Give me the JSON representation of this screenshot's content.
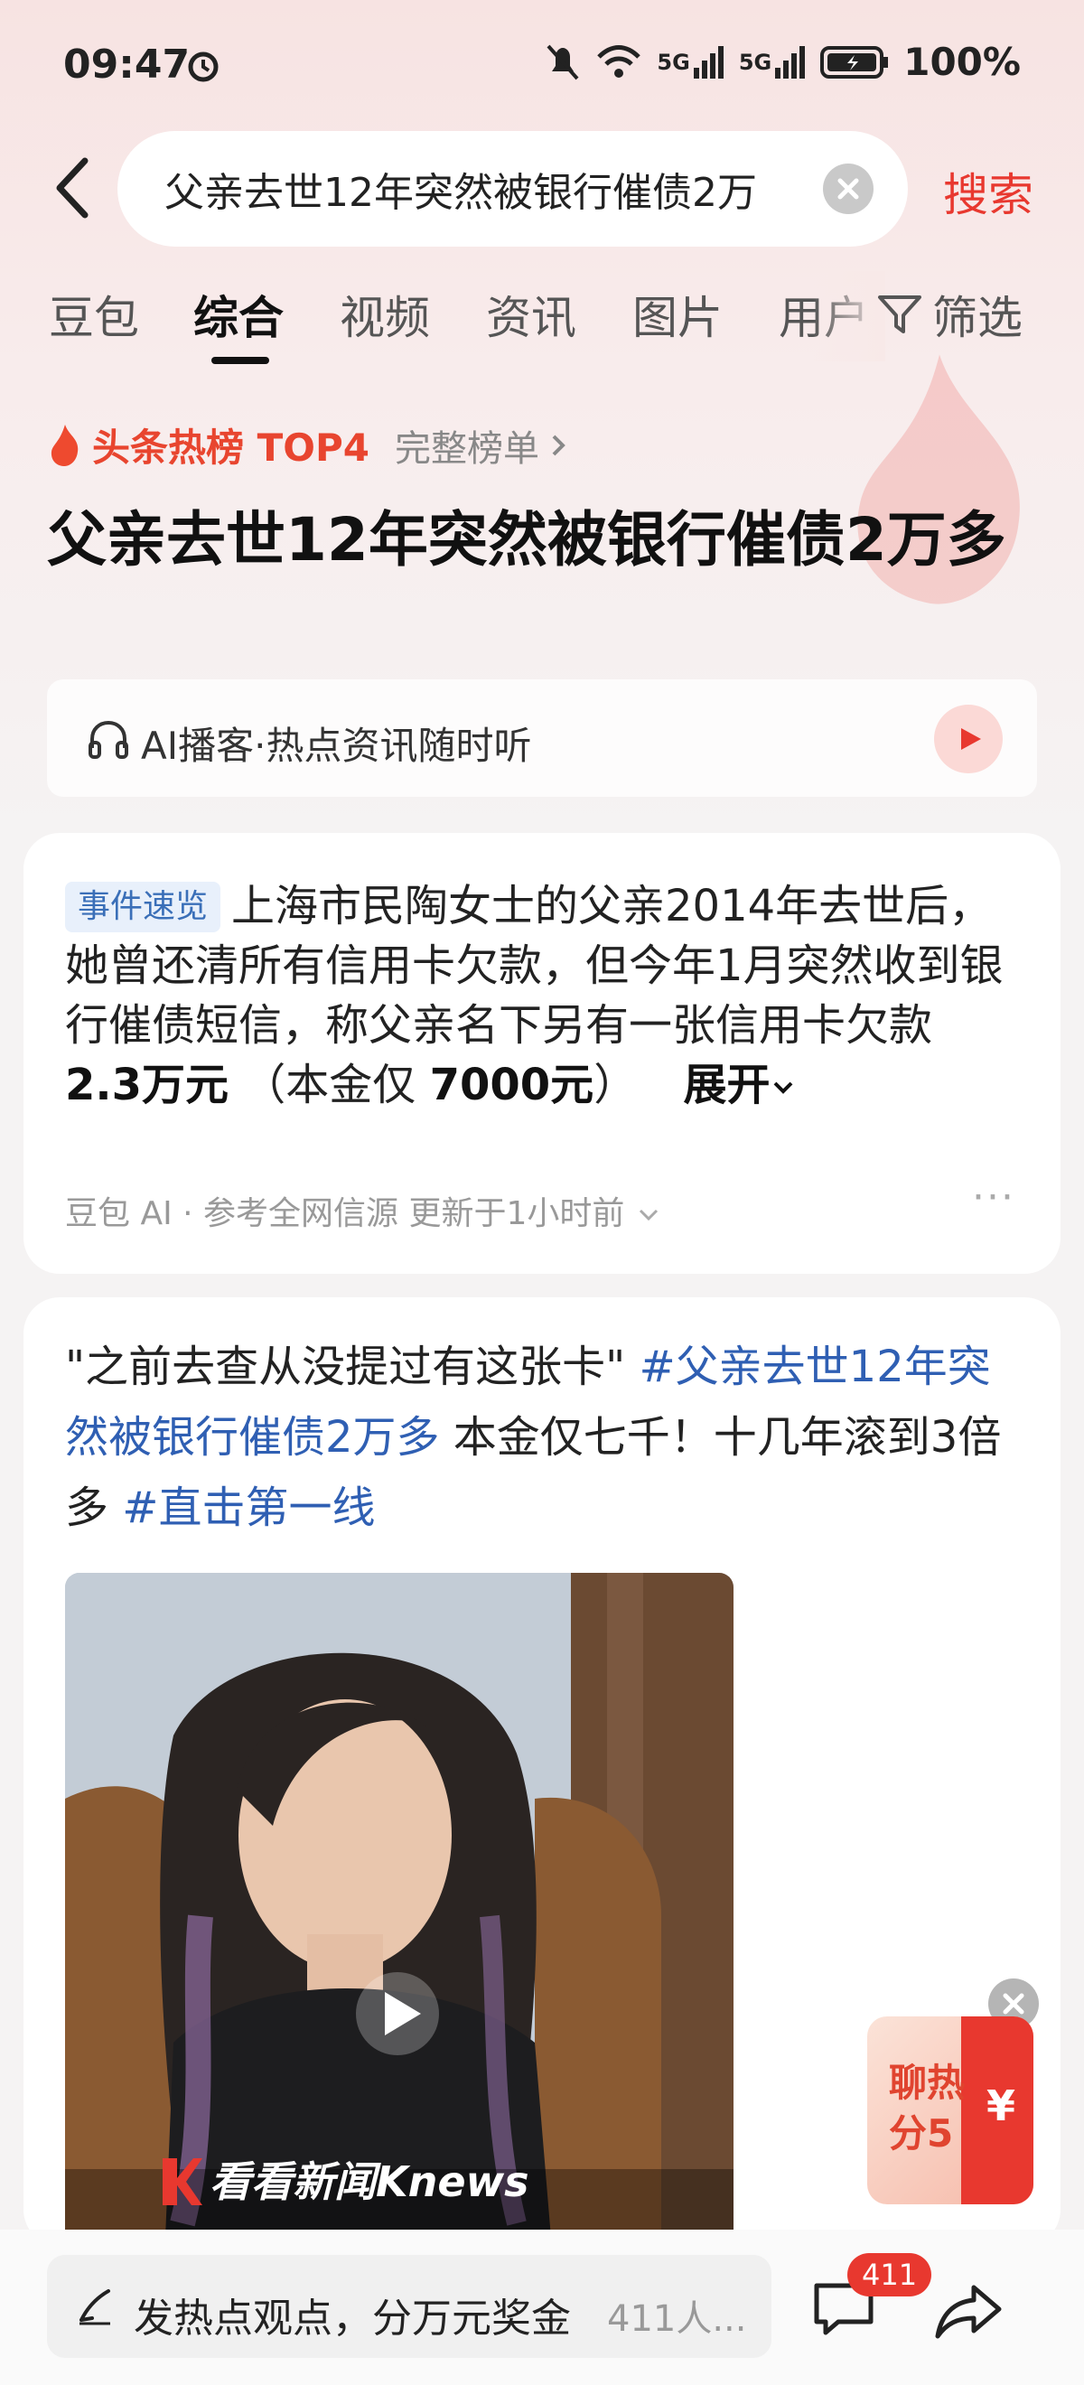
{
  "status_bar": {
    "time": "09:47",
    "network1": "5G",
    "network2": "5G",
    "battery": "100%"
  },
  "search": {
    "query": "父亲去世12年突然被银行催债2万",
    "button": "搜索"
  },
  "tabs": [
    "豆包",
    "综合",
    "视频",
    "资讯",
    "图片",
    "用户"
  ],
  "active_tab": "综合",
  "filter_label": "筛选",
  "hot": {
    "label": "头条热榜 TOP4",
    "full_list": "完整榜单"
  },
  "headline": "父亲去世12年突然被银行催债2万多",
  "ai_podcast": {
    "text": "AI播客·热点资讯随时听"
  },
  "summary_card": {
    "tag": "事件速览",
    "text_before": "上海市民陶女士的父亲2014年去世后，她曾还清所有信用卡欠款，但今年1月突然收到银行催债短信，称父亲名下另有一张信用卡欠款 ",
    "amount": "2.3万元",
    "text_mid": " （本金仅 ",
    "principal": "7000元",
    "text_after": "）",
    "expand": "展开",
    "source": "豆包 AI · 参考全网信源 更新于1小时前",
    "more": "···"
  },
  "post_card": {
    "quote": "\"之前去查从没提过有这张卡\"",
    "hashtag1": "#父亲去世12年突然被银行催债2万多",
    "middle": " 本金仅七千！十几年滚到3倍多 ",
    "hashtag2": "#直击第一线",
    "video_watermark": "看看新闻Knews"
  },
  "red_packet": {
    "line1": "聊热",
    "line2": "分5",
    "symbol": "¥"
  },
  "bottom": {
    "placeholder": "发热点观点，分万元奖金",
    "participants": "411人...",
    "comment_badge": "411"
  },
  "colors": {
    "accent": "#e8382f",
    "link": "#2f5fb3",
    "tag_bg": "#e8f0fb"
  }
}
